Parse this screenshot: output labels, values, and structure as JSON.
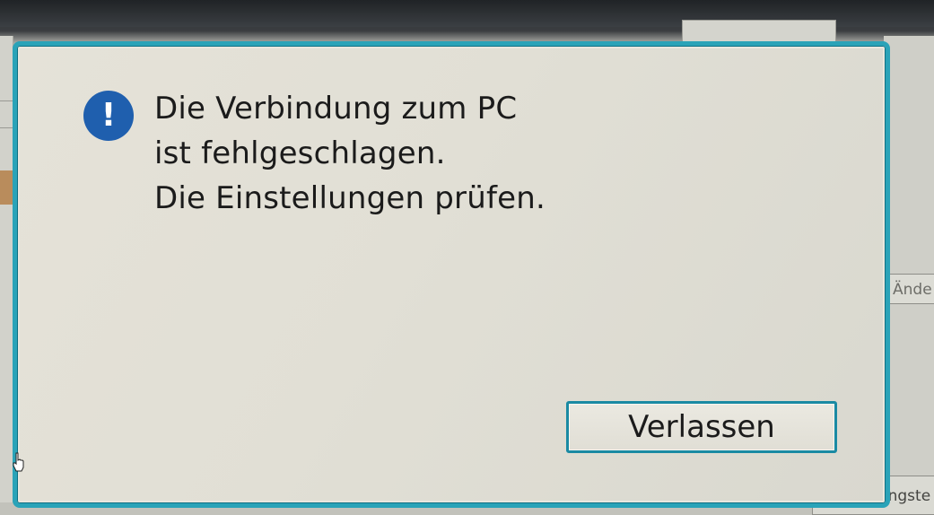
{
  "background": {
    "right_button_label": "Ände",
    "bottom_button_label": "Verbindungste"
  },
  "dialog": {
    "icon": "exclamation-icon",
    "icon_glyph": "!",
    "message_lines": [
      "Die Verbindung zum PC",
      "ist fehlgeschlagen.",
      "Die Einstellungen prüfen."
    ],
    "exit_label": "Verlassen"
  },
  "colors": {
    "dialog_border": "#2aa3b8",
    "icon_background": "#1f5fae",
    "button_border": "#1a8aa3"
  }
}
